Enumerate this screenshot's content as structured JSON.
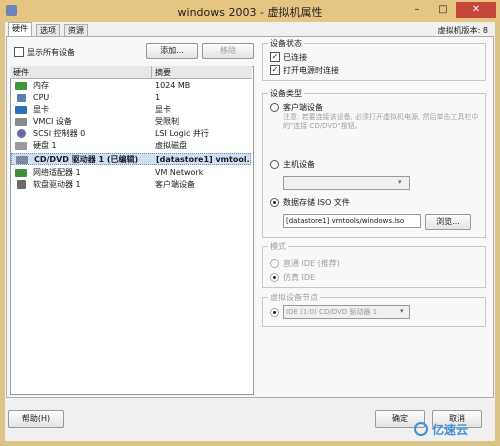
{
  "window": {
    "title": "windows 2003 - 虚拟机属性",
    "minimize": "–",
    "maximize": "□",
    "close": "✕"
  },
  "tabs": [
    {
      "label": "硬件"
    },
    {
      "label": "选项"
    },
    {
      "label": "资源"
    }
  ],
  "version_label": "虚拟机版本: 8",
  "show_all_label": "显示所有设备",
  "add_button": "添加...",
  "remove_button": "移除",
  "hardware_table": {
    "headers": [
      "硬件",
      "摘要"
    ],
    "rows": [
      {
        "name": "内存",
        "summary": "1024 MB",
        "icon": "memory-icon"
      },
      {
        "name": "CPU",
        "summary": "1",
        "icon": "cpu-icon"
      },
      {
        "name": "显卡",
        "summary": "显卡",
        "icon": "display-icon"
      },
      {
        "name": "VMCI 设备",
        "summary": "受限制",
        "icon": "vmci-icon"
      },
      {
        "name": "SCSI 控制器 0",
        "summary": "LSI Logic 并行",
        "icon": "scsi-icon"
      },
      {
        "name": "硬盘 1",
        "summary": "虚拟磁盘",
        "icon": "disk-icon"
      },
      {
        "name": "CD/DVD 驱动器 1 (已编辑)",
        "summary": "[datastore1] vmtool...",
        "icon": "cdrom-icon"
      },
      {
        "name": "网络适配器 1",
        "summary": "VM Network",
        "icon": "network-icon"
      },
      {
        "name": "软盘驱动器 1",
        "summary": "客户端设备",
        "icon": "floppy-icon"
      }
    ]
  },
  "device_status": {
    "title": "设备状态",
    "connected": "已连接",
    "connect_at_power_on": "打开电源时连接"
  },
  "device_type": {
    "title": "设备类型",
    "client_device": "客户端设备",
    "client_note": "注意: 若要连接该设备, 必须打开虚拟机电源, 然后单击工具栏中的\"连接 CD/DVD\"按钮。",
    "host_device": "主机设备",
    "datastore_iso": "数据存储 ISO 文件",
    "iso_path": "[datastore1] vmtools/windows.iso",
    "browse_button": "浏览..."
  },
  "mode": {
    "title": "模式",
    "passthrough": "直通 IDE (推荐)",
    "emulate": "仿真 IDE"
  },
  "virtual_node": {
    "title": "虚拟设备节点",
    "value": "IDE (1:0) CD/DVD 驱动器 1"
  },
  "footer": {
    "help_button": "帮助(H)",
    "ok_button": "确定",
    "cancel_button": "取消",
    "watermark": "亿速云"
  },
  "colors": {
    "titlebar": "#e6c582",
    "close": "#c7463a",
    "selection": "#cfe0f5"
  }
}
